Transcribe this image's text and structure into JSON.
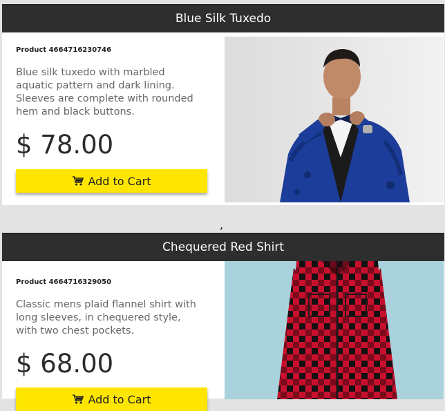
{
  "products": [
    {
      "title": "Blue Silk Tuxedo",
      "id_label": "Product 4664716230746",
      "description": "Blue silk tuxedo with marbled aquatic pattern and dark lining. Sleeves are complete with rounded hem and black buttons.",
      "price": "$ 78.00",
      "button_label": "Add to Cart",
      "button_icon": "cart-icon",
      "image": "man-in-blue-tuxedo-photo"
    },
    {
      "title": "Chequered Red Shirt",
      "id_label": "Product 4664716329050",
      "description": "Classic mens plaid flannel shirt with long sleeves, in chequered style, with two chest pockets.",
      "price": "$ 68.00",
      "button_label": "Add to Cart",
      "button_icon": "cart-icon",
      "image": "man-in-red-plaid-shirt-photo"
    }
  ],
  "separator": ",",
  "colors": {
    "header_bg": "#2e2e2e",
    "button_bg": "#ffe600",
    "page_bg": "#e3e3e3"
  }
}
